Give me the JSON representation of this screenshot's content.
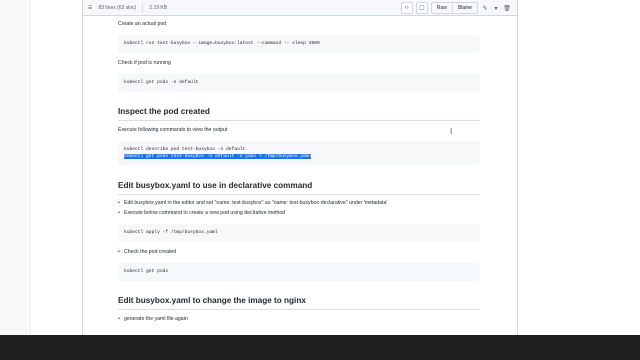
{
  "file_header": {
    "lines_info": "83 lines (63 sloc)",
    "size": "2.19 KB",
    "buttons": [
      "Raw",
      "Blame"
    ],
    "icons": [
      "list-icon",
      "code-icon",
      "copy-icon",
      "pencil-icon",
      "chevron-down-icon",
      "trash-icon"
    ]
  },
  "doc": {
    "p1": "Create an actual pod",
    "code1": "kubectl run test-busybox --image=busybox:latest --command -- sleep 3600",
    "p2": "Check if pod is running",
    "code2": "kubectl get pods -n default",
    "h_inspect": "Inspect the pod created",
    "p3": "Execute following commands to view the output",
    "code3_line1": "kubectl describe pod test-busybox -n default",
    "code3_line2": "kubectl get pods test-busybox -n default -o yaml > /tmp/busybox.yaml",
    "h_edit": "Edit busybox.yaml to use in declarative command",
    "li1": "Edit busybox.yaml in the editor and set \"name: test-busybox\" as \"name: test-busybox-declarative\" under 'metadata'",
    "li2": "Execute below command to create a new pod using declrative method",
    "code4": "kubectl apply -f /tmp/busybox.yaml",
    "li3": "Check the pod created",
    "code5": "kubectl get pods",
    "h_nginx": "Edit busybox.yaml to change the image to nginx",
    "li4": "generate the yaml file again"
  }
}
